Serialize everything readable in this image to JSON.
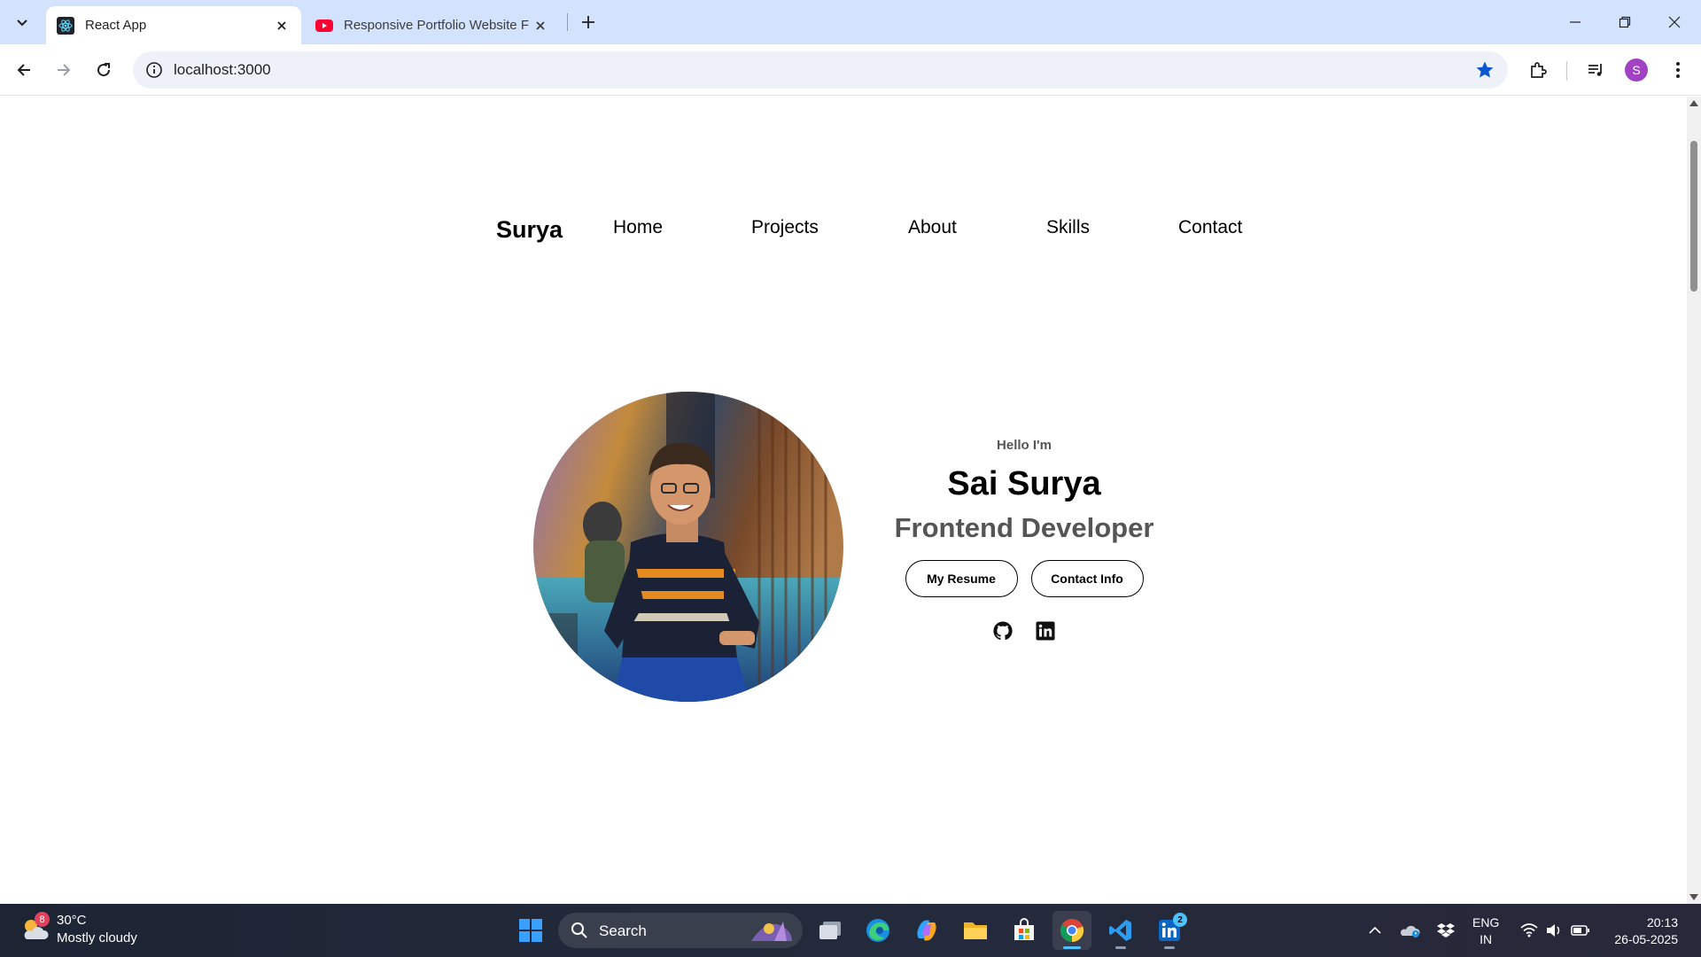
{
  "browser": {
    "tabs": [
      {
        "title": "React App",
        "favicon": "react-icon",
        "active": true
      },
      {
        "title": "Responsive Portfolio Website Fr",
        "favicon": "youtube-icon",
        "active": false
      }
    ],
    "url": "localhost:3000",
    "profile_initial": "S",
    "accent": "#0b57d0",
    "profile_color": "#a142c4"
  },
  "page": {
    "nav": {
      "brand": "Surya",
      "links": [
        "Home",
        "Projects",
        "About",
        "Skills",
        "Contact"
      ]
    },
    "hero": {
      "greeting": "Hello I'm",
      "name": "Sai Surya",
      "role": "Frontend Developer",
      "buttons": [
        "My Resume",
        "Contact Info"
      ],
      "socials": [
        "github-icon",
        "linkedin-icon"
      ]
    }
  },
  "taskbar": {
    "weather": {
      "temp": "30°C",
      "condition": "Mostly cloudy",
      "badge": "8"
    },
    "search_label": "Search",
    "linkedin_badge": "2",
    "language": {
      "line1": "ENG",
      "line2": "IN"
    },
    "clock": {
      "time": "20:13",
      "date": "26-05-2025"
    }
  }
}
